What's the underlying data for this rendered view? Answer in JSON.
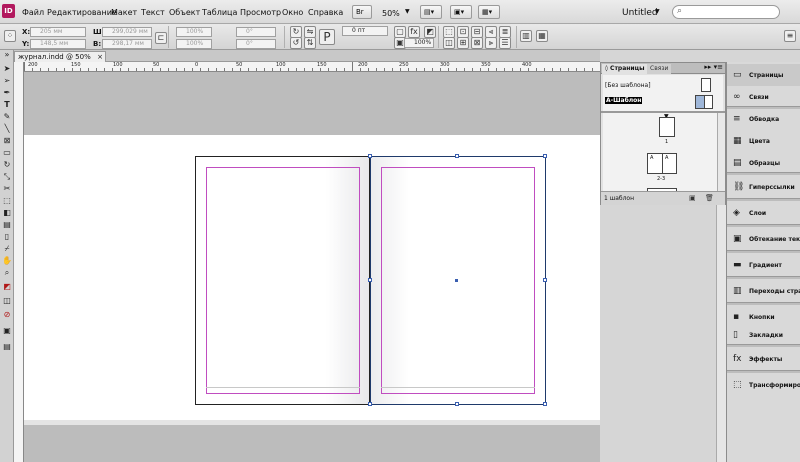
{
  "app": {
    "logo": "ID",
    "menu": [
      "Файл",
      "Редактирование",
      "Макет",
      "Текст",
      "Объект",
      "Таблица",
      "Просмотр",
      "Окно",
      "Справка"
    ],
    "zoom": "50%",
    "document_title": "Untitled",
    "search_placeholder": ""
  },
  "control_bar": {
    "x_label": "X:",
    "y_label": "Y:",
    "w_label": "Ш:",
    "h_label": "В:",
    "x_value": "205 мм",
    "y_value": "148,5 мм",
    "w_value": "299,029 мм",
    "h_value": "298,17 мм",
    "scale_x": "100%",
    "scale_y": "100%",
    "rotate": "0°",
    "shear": "0°",
    "stroke_weight": "0 пт",
    "opacity": "100%"
  },
  "document_tab": {
    "label": "журнал.indd @ 50%",
    "close": "×"
  },
  "ruler": {
    "labels": [
      "200",
      "150",
      "100",
      "50",
      "0",
      "50",
      "100",
      "150",
      "200",
      "250",
      "300",
      "350",
      "400"
    ]
  },
  "pages_panel": {
    "tab_pages": "◊ Страницы",
    "tab_links": "Связи",
    "menu_icon": "▸▸ ▾≡",
    "master_none": "[Без шаблона]",
    "master_a": "A-Шаблон",
    "page1_number": "1",
    "spread_number": "2-3",
    "thumb_letter_left": "A",
    "thumb_letter_right": "A",
    "footer_text": "1 шаблон"
  },
  "dock": [
    {
      "label": "Страницы",
      "icon": "pages-icon",
      "glyph": "▭"
    },
    {
      "label": "Связи",
      "icon": "links-icon",
      "glyph": "∞"
    },
    {
      "label": "Обводка",
      "icon": "stroke-icon",
      "glyph": "≡"
    },
    {
      "label": "Цвета",
      "icon": "swatch-icon",
      "glyph": "▦"
    },
    {
      "label": "Образцы",
      "icon": "swatches-icon",
      "glyph": "▤"
    },
    {
      "label": "Гиперссылки",
      "icon": "hyperlink-icon",
      "glyph": "⛓"
    },
    {
      "label": "Слои",
      "icon": "layers-icon",
      "glyph": "◈"
    },
    {
      "label": "Обтекание текстом",
      "icon": "text-wrap-icon",
      "glyph": "▣"
    },
    {
      "label": "Градиент",
      "icon": "gradient-icon",
      "glyph": "▬"
    },
    {
      "label": "Переходы страниц",
      "icon": "page-transitions-icon",
      "glyph": "▥"
    },
    {
      "label": "Кнопки",
      "icon": "buttons-icon",
      "glyph": "▪"
    },
    {
      "label": "Закладки",
      "icon": "bookmarks-icon",
      "glyph": "▯"
    },
    {
      "label": "Эффекты",
      "icon": "effects-icon",
      "glyph": "fx"
    },
    {
      "label": "Трансформирова",
      "icon": "transform-icon",
      "glyph": "⬚"
    }
  ]
}
